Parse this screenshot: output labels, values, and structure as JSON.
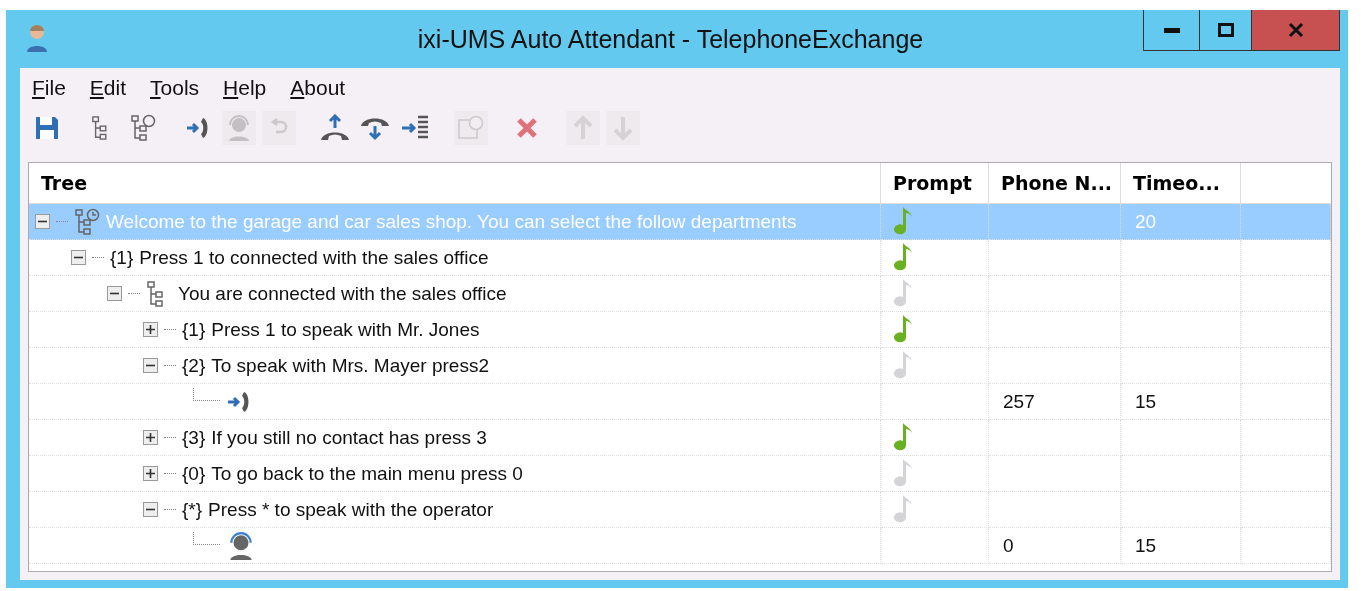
{
  "window": {
    "title": "ixi-UMS Auto Attendant - TelephoneExchange"
  },
  "menu": [
    {
      "label": "File"
    },
    {
      "label": "Edit"
    },
    {
      "label": "Tools"
    },
    {
      "label": "Help"
    },
    {
      "label": "About"
    }
  ],
  "toolbar": [
    {
      "kind": "save",
      "disabled": false
    },
    {
      "kind": "gap"
    },
    {
      "kind": "tree",
      "disabled": false
    },
    {
      "kind": "tree-clock",
      "disabled": false
    },
    {
      "kind": "gap"
    },
    {
      "kind": "transfer",
      "disabled": false
    },
    {
      "kind": "operator",
      "disabled": true
    },
    {
      "kind": "undo",
      "disabled": true
    },
    {
      "kind": "gap"
    },
    {
      "kind": "pickup",
      "disabled": false
    },
    {
      "kind": "hangup",
      "disabled": false
    },
    {
      "kind": "insert",
      "disabled": false
    },
    {
      "kind": "gap"
    },
    {
      "kind": "calendar",
      "disabled": true
    },
    {
      "kind": "gap"
    },
    {
      "kind": "delete",
      "disabled": false
    },
    {
      "kind": "gap"
    },
    {
      "kind": "up",
      "disabled": true
    },
    {
      "kind": "down",
      "disabled": true
    }
  ],
  "table": {
    "columns": [
      "Tree",
      "Prompt",
      "Phone N...",
      "Timeo..."
    ],
    "rows": [
      {
        "kind": "menu",
        "label": "Welcome to the garage and car sales shop. You can select the follow departments",
        "expanded": true,
        "selected": true,
        "prompt": true,
        "timeout": "20",
        "children": [
          {
            "kind": "key",
            "digit": "{1}",
            "label": "Press 1 to connected with the sales office",
            "expanded": true,
            "selected": false,
            "prompt": true,
            "children": [
              {
                "kind": "submenu",
                "label": "You are connected with the sales office",
                "expanded": true,
                "selected": false,
                "prompt": false,
                "children": [
                  {
                    "kind": "key",
                    "digit": "{1}",
                    "label": "Press 1 to speak with Mr. Jones",
                    "expanded": false,
                    "selected": false,
                    "prompt": true
                  },
                  {
                    "kind": "key",
                    "digit": "{2}",
                    "label": "To speak with Mrs. Mayer press2",
                    "expanded": true,
                    "selected": false,
                    "prompt": false,
                    "children": [
                      {
                        "kind": "transfer",
                        "selected": false,
                        "phone": "257",
                        "timeout": "15"
                      }
                    ]
                  },
                  {
                    "kind": "key",
                    "digit": "{3}",
                    "label": "If you still no contact has press 3",
                    "expanded": false,
                    "selected": false,
                    "prompt": true
                  },
                  {
                    "kind": "key",
                    "digit": "{0}",
                    "label": "To go back to the main menu press 0",
                    "expanded": false,
                    "selected": false,
                    "prompt": false
                  },
                  {
                    "kind": "key",
                    "digit": "{*}",
                    "label": "Press * to speak with the operator",
                    "expanded": true,
                    "selected": false,
                    "prompt": false,
                    "children": [
                      {
                        "kind": "operator",
                        "selected": false,
                        "phone": "0",
                        "timeout": "15"
                      }
                    ]
                  }
                ]
              }
            ]
          }
        ]
      }
    ]
  }
}
